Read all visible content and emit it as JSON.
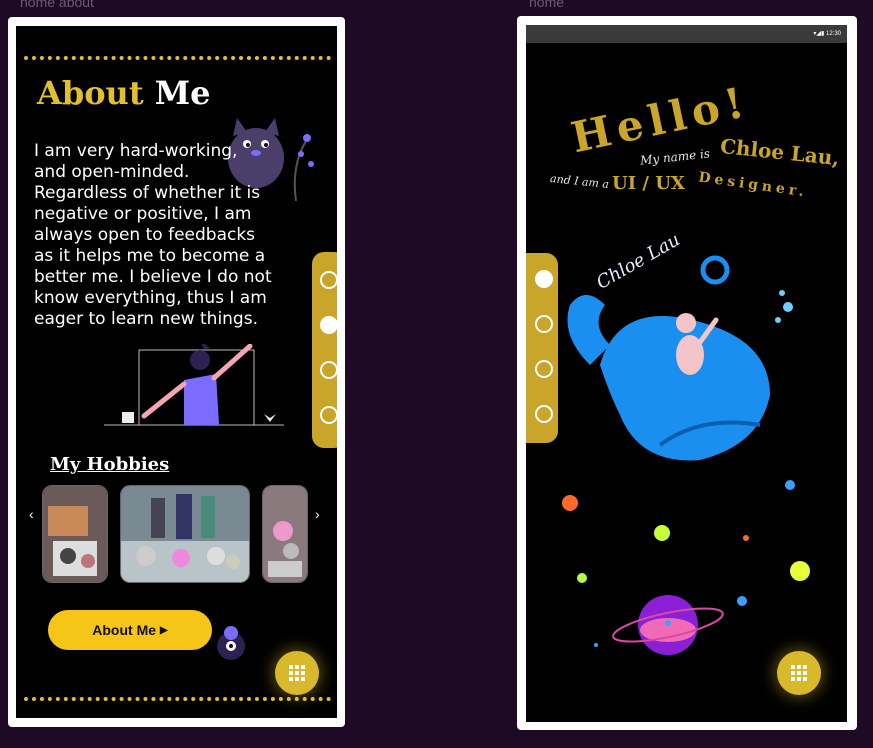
{
  "frames": {
    "left_label": "home about",
    "right_label": "home"
  },
  "about": {
    "title_highlight": "About",
    "title_rest": "Me",
    "body": "I am very hard-working, and open-minded. Regardless of whether it is negative or positive, I am always open to feedbacks as it helps me to become a better me. I believe I do not know everything, thus I am eager to learn new things.",
    "hobbies_heading": "My Hobbies",
    "button_label": "About Me",
    "nav_active_index": 2
  },
  "home": {
    "status_time": "12:30",
    "hello": "Hello!",
    "my_name_is": "My name is",
    "name": "Chloe Lau,",
    "and_i_am_a": "and I am a",
    "role_a": "UI / UX",
    "role_b": "Designer.",
    "whale_caption": "Chloe Lau",
    "nav_active_index": 1
  },
  "colors": {
    "accent": "#e2c02a",
    "background": "#1f0a26",
    "whale": "#1b8ff0"
  },
  "icons": {
    "menu": "grid-icon",
    "carousel_prev": "chevron-left-icon",
    "carousel_next": "chevron-right-icon",
    "button": "caret-right-icon"
  }
}
